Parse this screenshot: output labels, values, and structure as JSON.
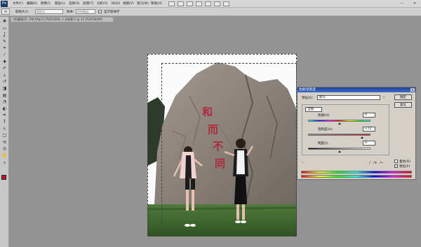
{
  "app": {
    "logo": "Ps"
  },
  "menu": [
    {
      "label": "文件(F)"
    },
    {
      "label": "编辑(E)"
    },
    {
      "label": "图像(I)"
    },
    {
      "label": "图层(L)"
    },
    {
      "label": "选择(S)"
    },
    {
      "label": "滤镜(T)"
    },
    {
      "label": "分析(A)"
    },
    {
      "label": "3D(D)"
    },
    {
      "label": "视图(V)"
    },
    {
      "label": "窗口(W)"
    },
    {
      "label": "帮助(H)"
    }
  ],
  "window_controls": {
    "minimize": "—",
    "close": "✕"
  },
  "options_bar": {
    "tool_glyph": "⊙",
    "sample_size_label": "取样大小:",
    "sample_size_value": "取样点",
    "sample_label": "样本:",
    "sample_value": "所有图层",
    "checkbox_checked": "✓",
    "checkbox_label": "显示取样环"
  },
  "document_tab": {
    "title": "QQ截图20...MH.tif@33.3%(RGB/8) × 未标题-1 @ 33.3%(RGB/8#)"
  },
  "toolbox": {
    "tools": [
      {
        "name": "move-tool-icon",
        "glyph": "✥"
      },
      {
        "name": "marquee-tool-icon",
        "glyph": "▭"
      },
      {
        "name": "lasso-tool-icon",
        "glyph": "ʆ"
      },
      {
        "name": "quick-select-tool-icon",
        "glyph": "✎"
      },
      {
        "name": "crop-tool-icon",
        "glyph": "⌗"
      },
      {
        "name": "eyedropper-tool-icon",
        "glyph": "⁄"
      },
      {
        "name": "healing-tool-icon",
        "glyph": "✚"
      },
      {
        "name": "brush-tool-icon",
        "glyph": "✐"
      },
      {
        "name": "clone-stamp-tool-icon",
        "glyph": "⊥"
      },
      {
        "name": "history-brush-tool-icon",
        "glyph": "↺"
      },
      {
        "name": "eraser-tool-icon",
        "glyph": "◨"
      },
      {
        "name": "gradient-tool-icon",
        "glyph": "▤"
      },
      {
        "name": "blur-tool-icon",
        "glyph": "◔"
      },
      {
        "name": "dodge-tool-icon",
        "glyph": "◐"
      },
      {
        "name": "pen-tool-icon",
        "glyph": "✒"
      },
      {
        "name": "type-tool-icon",
        "glyph": "T"
      },
      {
        "name": "path-select-tool-icon",
        "glyph": "↖"
      },
      {
        "name": "shape-tool-icon",
        "glyph": "□"
      },
      {
        "name": "3d-rotate-tool-icon",
        "glyph": "⟲"
      },
      {
        "name": "3d-orbit-tool-icon",
        "glyph": "◎"
      },
      {
        "name": "hand-tool-icon",
        "glyph": "✋"
      },
      {
        "name": "zoom-tool-icon",
        "glyph": "⌕"
      }
    ],
    "fg_color": "#c8102e",
    "bg_color": "#ffffff"
  },
  "dialog": {
    "title": "色相/饱和度",
    "close_glyph": "✕",
    "preset_label": "预设(E):",
    "preset_value": "默认",
    "channel_value": "全图",
    "ok": "确定",
    "cancel": "复位",
    "hue_label": "色相(H):",
    "hue_value": "0",
    "hue_position": 0.5,
    "saturation_label": "饱和度(A):",
    "saturation_value": "+72",
    "saturation_position": 0.86,
    "lightness_label": "明度(I):",
    "lightness_value": "0",
    "lightness_position": 0.5,
    "colorize_label": "着色(O)",
    "preview_label": "预览(P)",
    "preview_checked": "✓",
    "eyedropper_glyphs": [
      "⁄",
      "⁄+",
      "⁄−"
    ],
    "hand_glyph": "☞"
  },
  "canvas_image": {
    "rock_text": [
      "和",
      "而",
      "不",
      "同"
    ],
    "text_color": "#b0283c"
  }
}
